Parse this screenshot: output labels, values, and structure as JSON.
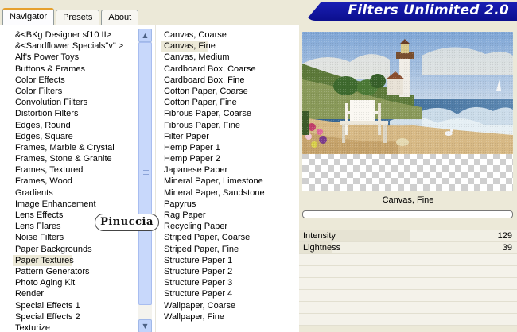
{
  "tabs": [
    "Navigator",
    "Presets",
    "About"
  ],
  "banner": "Filters Unlimited 2.0",
  "categories": [
    "&<BKg Designer sf10 II>",
    "&<Sandflower Specials\"v\" >",
    "Alf's Power Toys",
    "Buttons & Frames",
    "Color Effects",
    "Color Filters",
    "Convolution Filters",
    "Distortion Filters",
    "Edges, Round",
    "Edges, Square",
    "Frames, Marble & Crystal",
    "Frames, Stone & Granite",
    "Frames, Textured",
    "Frames, Wood",
    "Gradients",
    "Image Enhancement",
    "Lens Effects",
    "Lens Flares",
    "Noise Filters",
    "Paper Backgrounds",
    "Paper Textures",
    "Pattern Generators",
    "Photo Aging Kit",
    "Render",
    "Special Effects 1",
    "Special Effects 2",
    "Texturize"
  ],
  "selected_category": "Paper Textures",
  "filters": [
    "Canvas, Coarse",
    "Canvas, Fine",
    "Canvas, Medium",
    "Cardboard Box, Coarse",
    "Cardboard Box, Fine",
    "Cotton Paper, Coarse",
    "Cotton Paper, Fine",
    "Fibrous Paper, Coarse",
    "Fibrous Paper, Fine",
    "Filter Paper",
    "Hemp Paper 1",
    "Hemp Paper 2",
    "Japanese Paper",
    "Mineral Paper, Limestone",
    "Mineral Paper, Sandstone",
    "Papyrus",
    "Rag Paper",
    "Recycling Paper",
    "Striped Paper, Coarse",
    "Striped Paper, Fine",
    "Structure Paper 1",
    "Structure Paper 2",
    "Structure Paper 3",
    "Structure Paper 4",
    "Wallpaper, Coarse",
    "Wallpaper, Fine"
  ],
  "selected_filter": "Canvas, Fine",
  "filter_name": "Canvas, Fine",
  "params": [
    {
      "label": "Intensity",
      "value": "129",
      "fraction": 0.506
    },
    {
      "label": "Lightness",
      "value": "39",
      "fraction": 0.153
    }
  ],
  "watermark": "Pinuccia",
  "colors": {
    "banner": "#0c0f8e",
    "tab_accent": "#e6a02c",
    "selection": "#ece9d8",
    "scrollbar": "#c1d3fb"
  },
  "icons": {
    "scroll_up": "chevron-up-icon",
    "scroll_down": "chevron-down-icon"
  }
}
